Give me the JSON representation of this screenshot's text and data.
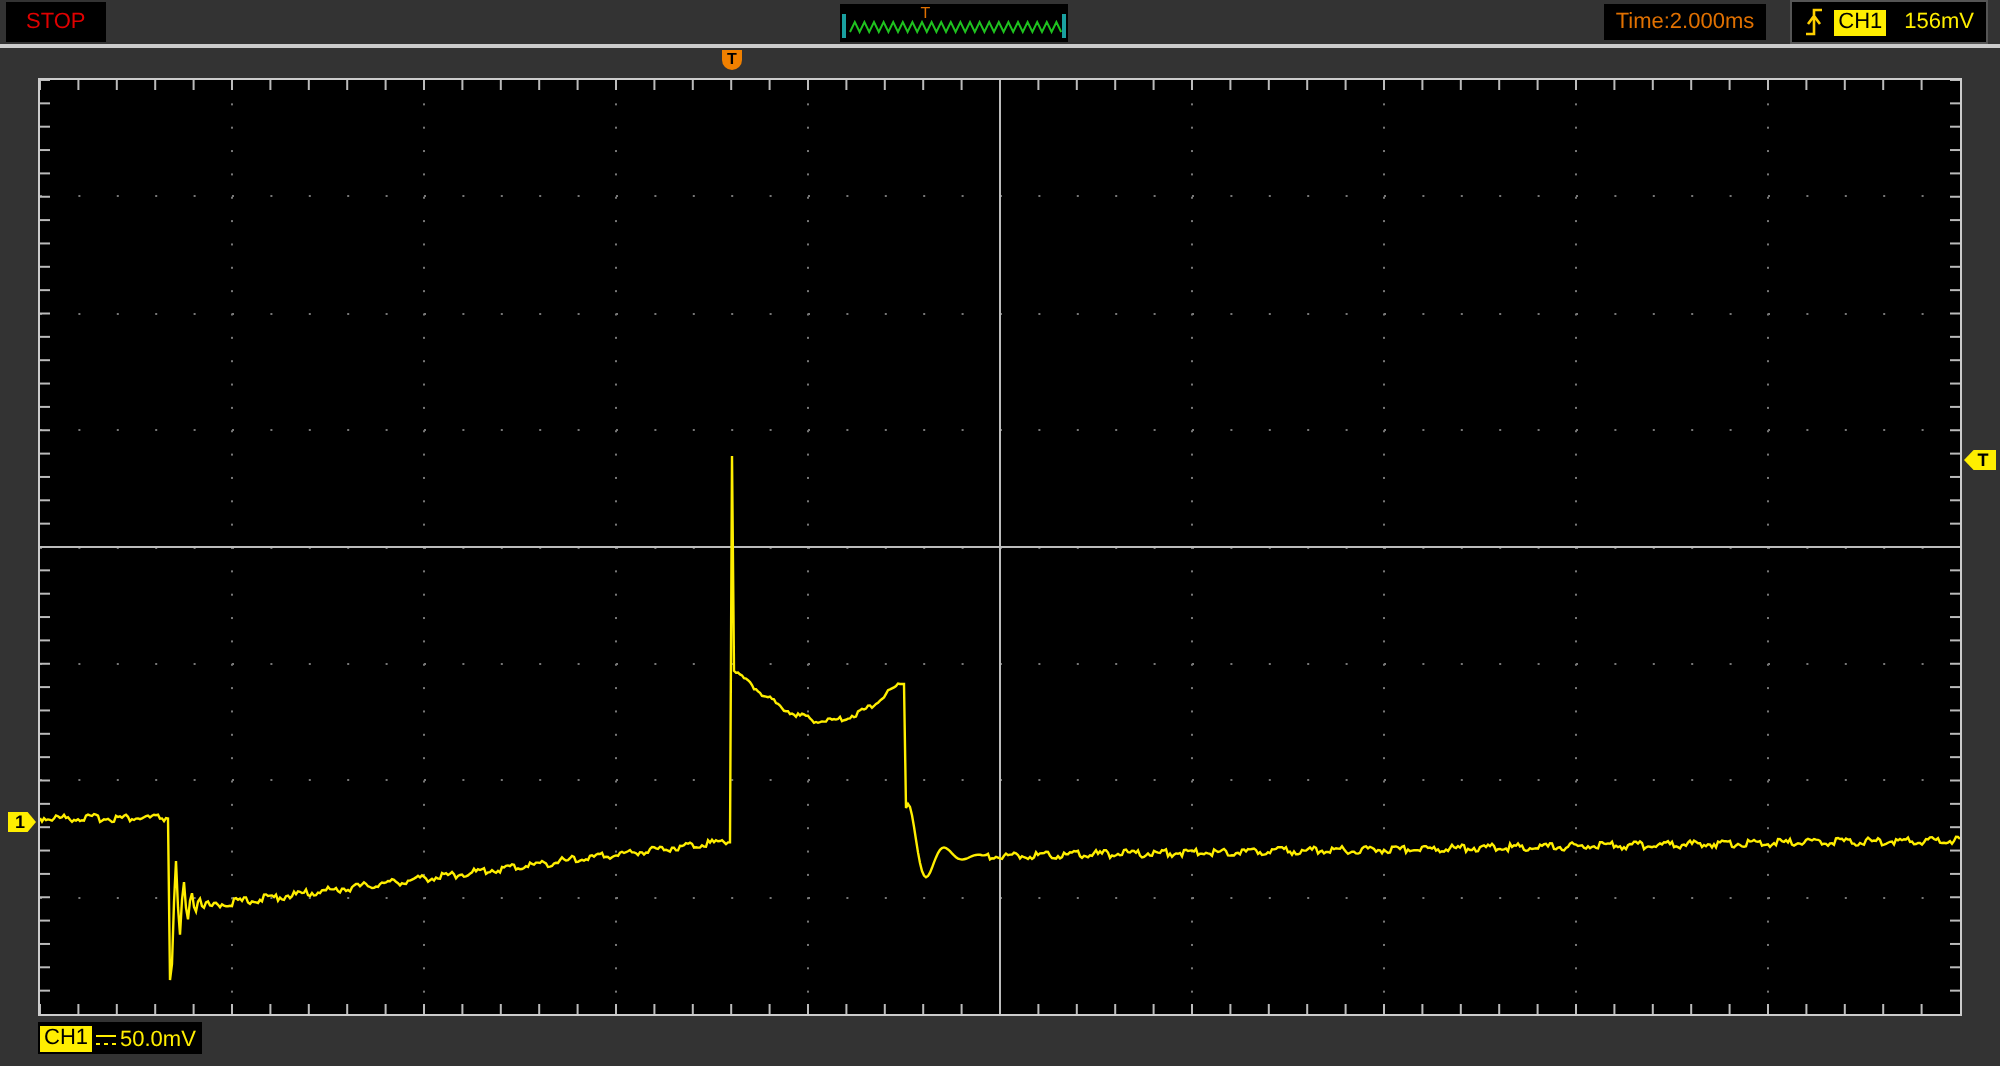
{
  "status": "STOP",
  "overview": {
    "trigger_mark": "T"
  },
  "timebase": "Time:2.000ms",
  "trigger": {
    "channel": "CH1",
    "level": "156mV"
  },
  "markers": {
    "trigger_position": "T",
    "trigger_level": "T",
    "channel": "1"
  },
  "channel_info": {
    "channel": "CH1",
    "scale": "50.0mV"
  }
}
